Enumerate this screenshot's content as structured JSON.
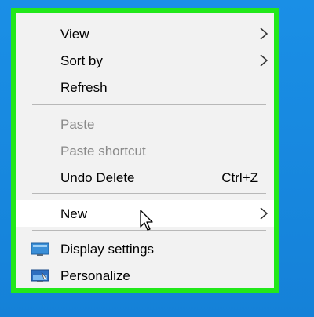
{
  "menu": {
    "view": "View",
    "sort_by": "Sort by",
    "refresh": "Refresh",
    "paste": "Paste",
    "paste_shortcut": "Paste shortcut",
    "undo_delete": "Undo Delete",
    "undo_shortcut": "Ctrl+Z",
    "new": "New",
    "display_settings": "Display settings",
    "personalize": "Personalize"
  },
  "colors": {
    "desktop": "#1581d8",
    "highlight_border": "#22e81a",
    "menu_bg": "#f2f2f2",
    "disabled_text": "#8a8a8a"
  },
  "icons": {
    "submenu": "chevron-right-icon",
    "display_settings": "display-settings-icon",
    "personalize": "personalize-icon",
    "cursor": "mouse-pointer-icon"
  }
}
